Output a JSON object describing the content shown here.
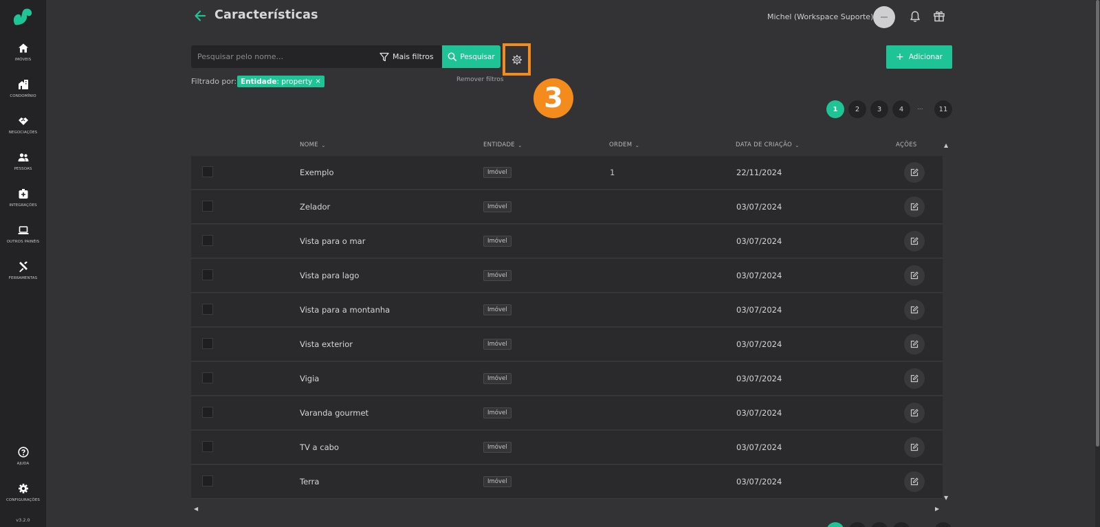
{
  "header": {
    "title": "Características",
    "user_name": "Michel (Workspace Suporte)"
  },
  "sidebar": {
    "items": [
      {
        "label": "IMÓVEIS",
        "icon": "home-icon"
      },
      {
        "label": "CONDOMÍNIO",
        "icon": "building-icon"
      },
      {
        "label": "NEGOCIAÇÕES",
        "icon": "handshake-icon"
      },
      {
        "label": "PESSOAS",
        "icon": "people-icon"
      },
      {
        "label": "INTEGRAÇÕES",
        "icon": "integration-icon"
      },
      {
        "label": "OUTROS PAINÉIS",
        "icon": "laptop-icon"
      },
      {
        "label": "FERRAMENTAS",
        "icon": "tools-icon"
      }
    ],
    "bottom_items": [
      {
        "label": "AJUDA",
        "icon": "help-icon"
      },
      {
        "label": "CONFIGURAÇÕES",
        "icon": "gear-icon"
      }
    ],
    "version": "v3.2.0"
  },
  "search": {
    "placeholder": "Pesquisar pelo nome...",
    "value": "",
    "more_filters_label": "Mais filtros",
    "search_button_label": "Pesquisar"
  },
  "add_button_label": "Adicionar",
  "step_badge": "3",
  "filters": {
    "filtered_by_label": "Filtrado por:",
    "chip_key": "Entidade",
    "chip_value": ": property",
    "chip_close": "×",
    "remove_filters_label": "Remover filtros"
  },
  "pagination": {
    "pages": [
      "1",
      "2",
      "3",
      "4"
    ],
    "ellipsis": "...",
    "last": "11",
    "active": "1"
  },
  "table": {
    "columns": [
      "NOME",
      "ENTIDADE",
      "ORDEM",
      "DATA DE CRIAÇÃO",
      "AÇÕES"
    ],
    "rows": [
      {
        "name": "Exemplo",
        "entity": "Imóvel",
        "order": "1",
        "date": "22/11/2024"
      },
      {
        "name": "Zelador",
        "entity": "Imóvel",
        "order": "",
        "date": "03/07/2024"
      },
      {
        "name": "Vista para o mar",
        "entity": "Imóvel",
        "order": "",
        "date": "03/07/2024"
      },
      {
        "name": "Vista para lago",
        "entity": "Imóvel",
        "order": "",
        "date": "03/07/2024"
      },
      {
        "name": "Vista para a montanha",
        "entity": "Imóvel",
        "order": "",
        "date": "03/07/2024"
      },
      {
        "name": "Vista exterior",
        "entity": "Imóvel",
        "order": "",
        "date": "03/07/2024"
      },
      {
        "name": "Vigia",
        "entity": "Imóvel",
        "order": "",
        "date": "03/07/2024"
      },
      {
        "name": "Varanda gourmet",
        "entity": "Imóvel",
        "order": "",
        "date": "03/07/2024"
      },
      {
        "name": "TV a cabo",
        "entity": "Imóvel",
        "order": "",
        "date": "03/07/2024"
      },
      {
        "name": "Terra",
        "entity": "Imóvel",
        "order": "",
        "date": "03/07/2024"
      }
    ]
  },
  "colors": {
    "accent": "#1ec495",
    "highlight": "#f38b1d",
    "background": "#333335",
    "sidebar": "#232325",
    "row": "#2a2a2c"
  }
}
